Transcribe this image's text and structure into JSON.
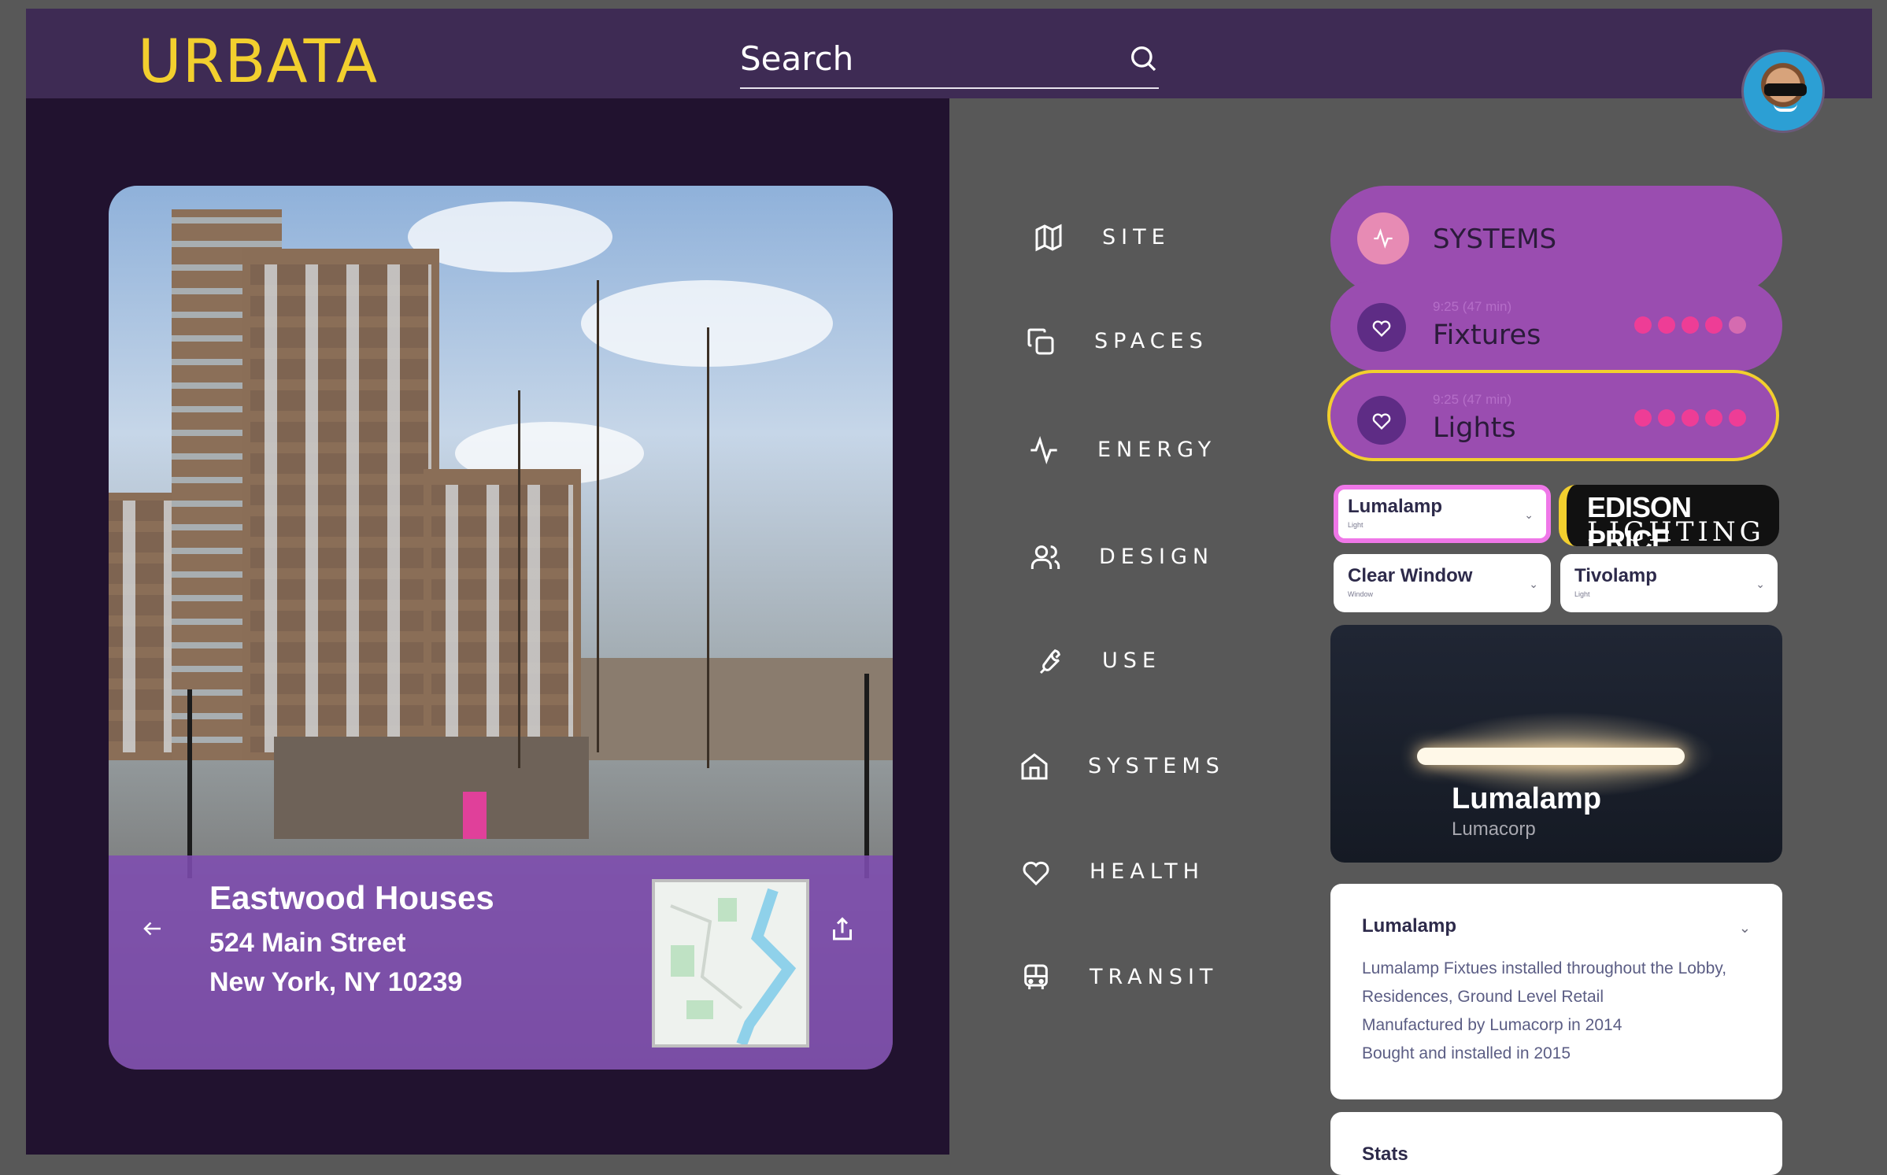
{
  "app": {
    "logo": "URBATA"
  },
  "search": {
    "value": "Search",
    "placeholder": "Search"
  },
  "hero": {
    "title": "Eastwood Houses",
    "address_line1": "524 Main Street",
    "address_line2": "New York, NY 10239"
  },
  "nav": {
    "items": [
      {
        "label": "SITE",
        "icon": "map-icon"
      },
      {
        "label": "SPACES",
        "icon": "copy-icon"
      },
      {
        "label": "ENERGY",
        "icon": "pulse-icon"
      },
      {
        "label": "DESIGN",
        "icon": "users-icon"
      },
      {
        "label": "USE",
        "icon": "wrench-icon"
      },
      {
        "label": "SYSTEMS",
        "icon": "home-icon"
      },
      {
        "label": "HEALTH",
        "icon": "heart-icon"
      },
      {
        "label": "TRANSIT",
        "icon": "bus-icon"
      }
    ]
  },
  "systems": {
    "header": "SYSTEMS",
    "fixtures": {
      "time": "9:25 (47 min)",
      "name": "Fixtures",
      "rating": 4,
      "rating_max": 5
    },
    "lights": {
      "time": "9:25 (47 min)",
      "name": "Lights",
      "rating": 5,
      "rating_max": 5
    }
  },
  "selectors": [
    {
      "title": "Lumalamp",
      "subtitle": "Light"
    },
    {
      "title": "Clear Window",
      "subtitle": "Window"
    },
    {
      "title": "Tivolamp",
      "subtitle": "Light"
    }
  ],
  "brand": {
    "line1": "EDISON PRICE",
    "line2": "LIGHTING"
  },
  "product": {
    "name": "Lumalamp",
    "maker": "Lumacorp"
  },
  "details": {
    "title": "Lumalamp",
    "lines": [
      "Lumalamp Fixtues installed throughout the Lobby,",
      "Residences, Ground Level Retail",
      "Manufactured by Lumacorp in 2014",
      "Bought and installed in 2015"
    ]
  },
  "stats": {
    "title": "Stats"
  },
  "colors": {
    "accent": "#f2cf2e",
    "purple": "#9a4db0",
    "dark": "#21122f",
    "topbar": "#3e2b54",
    "rating": "#ee3d96"
  }
}
